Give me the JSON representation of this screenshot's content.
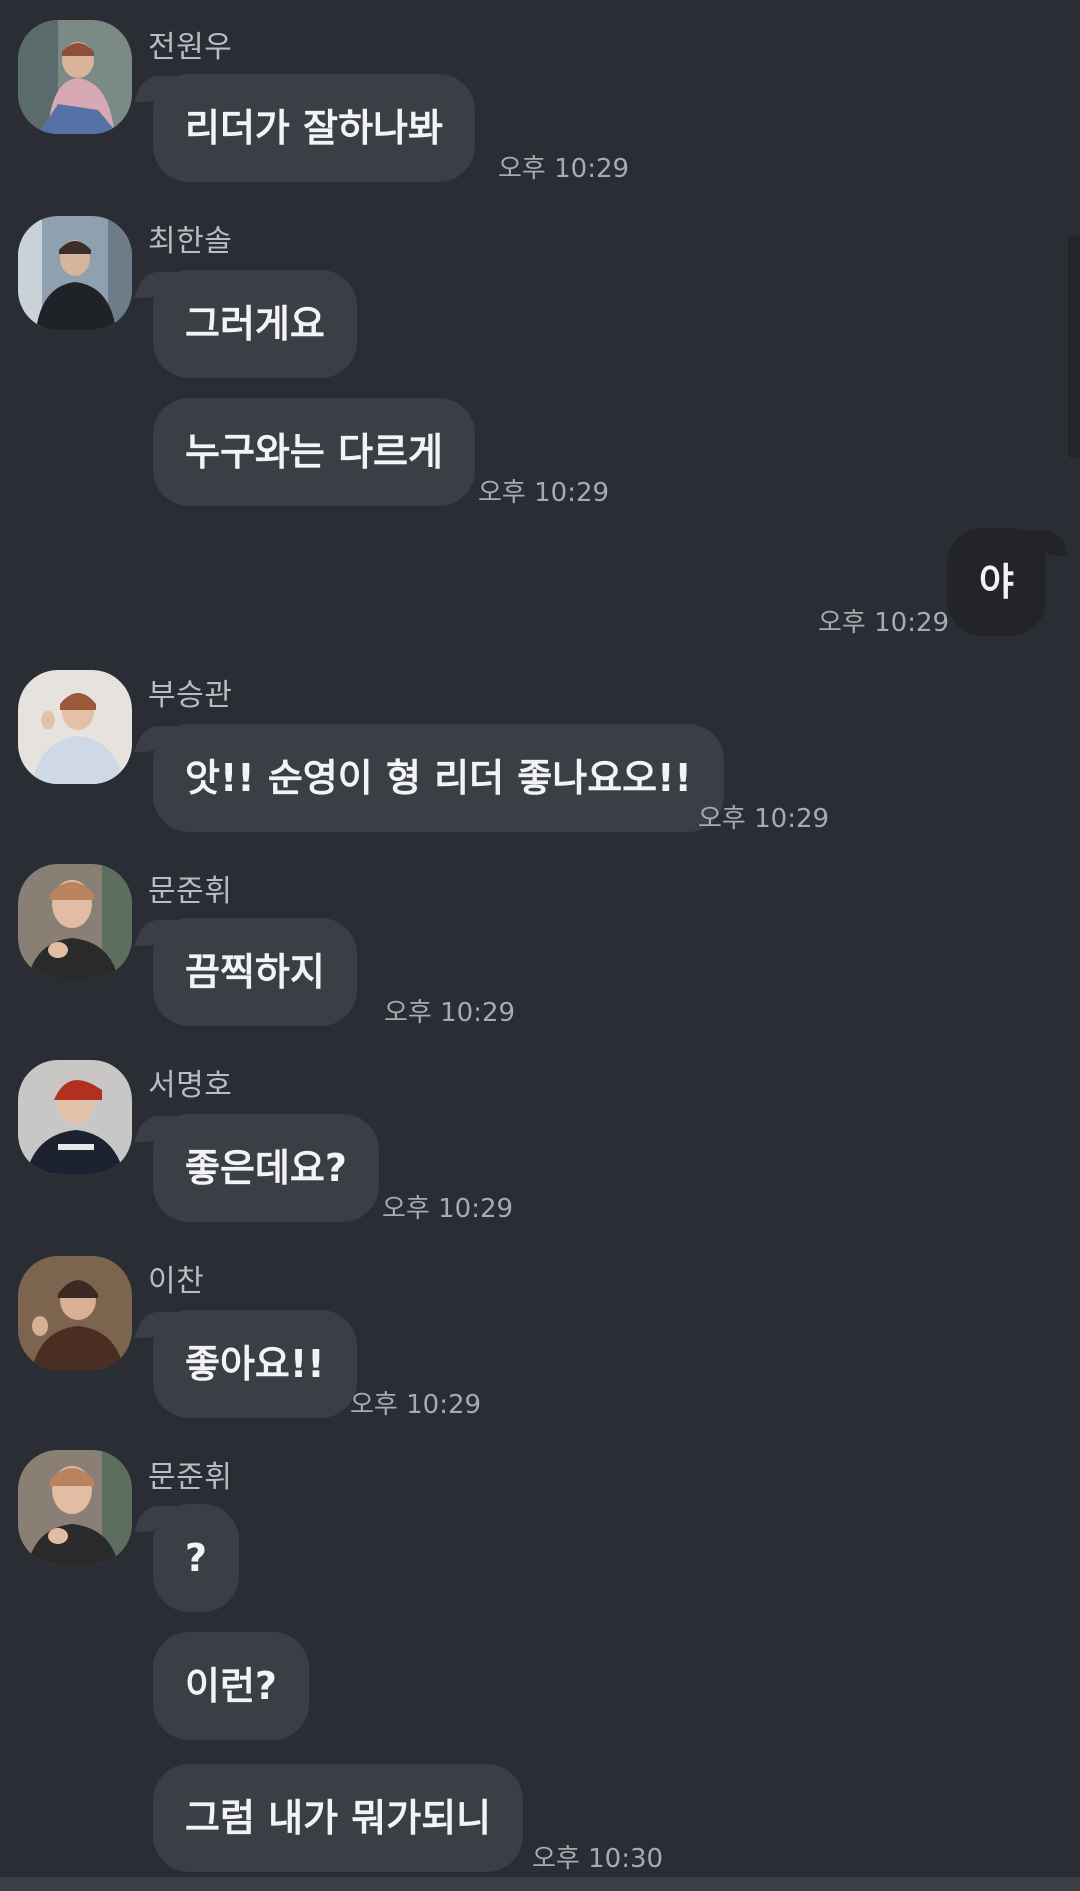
{
  "messages": [
    {
      "sender": "전원우",
      "bubbles": [
        "리더가 잘하나봐"
      ],
      "time": "오후 10:29"
    },
    {
      "sender": "최한솔",
      "bubbles": [
        "그러게요",
        "누구와는 다르게"
      ],
      "time": "오후 10:29"
    },
    {
      "sender": "",
      "mine": true,
      "bubbles": [
        "야"
      ],
      "time": "오후 10:29"
    },
    {
      "sender": "부승관",
      "bubbles": [
        "앗!! 순영이 형 리더 좋나요오!!"
      ],
      "time": "오후 10:29"
    },
    {
      "sender": "문준휘",
      "bubbles": [
        "끔찍하지"
      ],
      "time": "오후 10:29"
    },
    {
      "sender": "서명호",
      "bubbles": [
        "좋은데요?"
      ],
      "time": "오후 10:29"
    },
    {
      "sender": "이찬",
      "bubbles": [
        "좋아요!!"
      ],
      "time": "오후 10:29"
    },
    {
      "sender": "문준휘",
      "bubbles": [
        "?",
        "이런?",
        "그럼 내가 뭐가되니"
      ],
      "time": "오후 10:30"
    }
  ],
  "colors": {
    "background": "#2a2d33",
    "bubble_other": "#3b3e44",
    "bubble_mine": "#222428",
    "sender_text": "#b9bcc2",
    "time_text": "#a7aab0"
  },
  "icons": {
    "avatar": "profile-photo"
  }
}
